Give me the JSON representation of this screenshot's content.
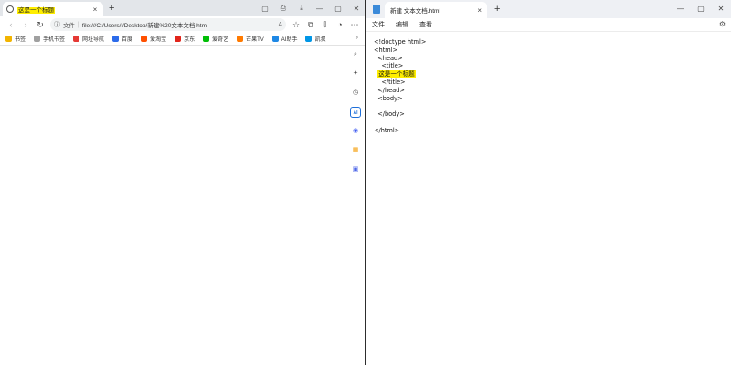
{
  "browser": {
    "tab_title": "这是一个标题",
    "tab_close": "×",
    "new_tab": "+",
    "window_controls": [
      "▢",
      "⎙",
      "⤓",
      "—",
      "▢",
      "✕"
    ],
    "toolbar": {
      "back": "‹",
      "forward": "›",
      "refresh": "↻",
      "info": "ⓘ",
      "file_label": "文件",
      "separator": "|",
      "url": "file:///C:/Users/l/Desktop/新建%20文本文档.html",
      "read_aloud": "A",
      "right_icons": [
        "☆",
        "⧉",
        "⇩",
        "◔",
        "⋯"
      ]
    },
    "bookmarks": [
      {
        "label": "书签",
        "icon": "star-icon",
        "color": "#f2b400"
      },
      {
        "label": "手机书签",
        "icon": "phone-icon",
        "color": "#a0a0a0"
      },
      {
        "label": "网址导航",
        "icon": "nav-icon",
        "color": "#e53935"
      },
      {
        "label": "百度",
        "icon": "baidu-icon",
        "color": "#2c6bea"
      },
      {
        "label": "爱淘宝",
        "icon": "taobao-icon",
        "color": "#ff5000"
      },
      {
        "label": "京东",
        "icon": "jd-icon",
        "color": "#e1251b"
      },
      {
        "label": "爱奇艺",
        "icon": "iqiyi-icon",
        "color": "#00be06"
      },
      {
        "label": "芒果TV",
        "icon": "mango-icon",
        "color": "#ff7a00"
      },
      {
        "label": "AI助手",
        "icon": "ai-icon",
        "color": "#1e88e5"
      },
      {
        "label": "凯叔",
        "icon": "kaishu-icon",
        "color": "#0096e6"
      }
    ],
    "bookmarks_more": "›",
    "sidebar": [
      {
        "icon": "search-icon",
        "glyph": "⌕",
        "color": "#555"
      },
      {
        "icon": "sparkle-icon",
        "glyph": "✦",
        "color": "#555"
      },
      {
        "icon": "clock-icon",
        "glyph": "◷",
        "color": "#555"
      },
      {
        "icon": "ai-icon",
        "glyph": "AI",
        "color": "#1e6fd9"
      },
      {
        "icon": "game-icon",
        "glyph": "◉",
        "color": "#3d5af1"
      },
      {
        "icon": "bag-icon",
        "glyph": "▦",
        "color": "#f59b00"
      },
      {
        "icon": "app-icon",
        "glyph": "▣",
        "color": "#4d66e8"
      }
    ]
  },
  "notepad": {
    "tab_title": "新建 文本文档.html",
    "tab_close": "×",
    "new_tab": "+",
    "window_controls": [
      "—",
      "▢",
      "✕"
    ],
    "menu": [
      "文件",
      "编辑",
      "查看"
    ],
    "settings": "⚙",
    "lines": [
      "<!doctype html>",
      "<html>",
      "  <head>",
      "    <title>",
      "这是一个标题",
      "    </title>",
      "  </head>",
      "  <body>",
      "",
      "  </body>",
      "",
      "</html>"
    ],
    "highlight_line": 4,
    "highlight_color": "#ffee00"
  }
}
